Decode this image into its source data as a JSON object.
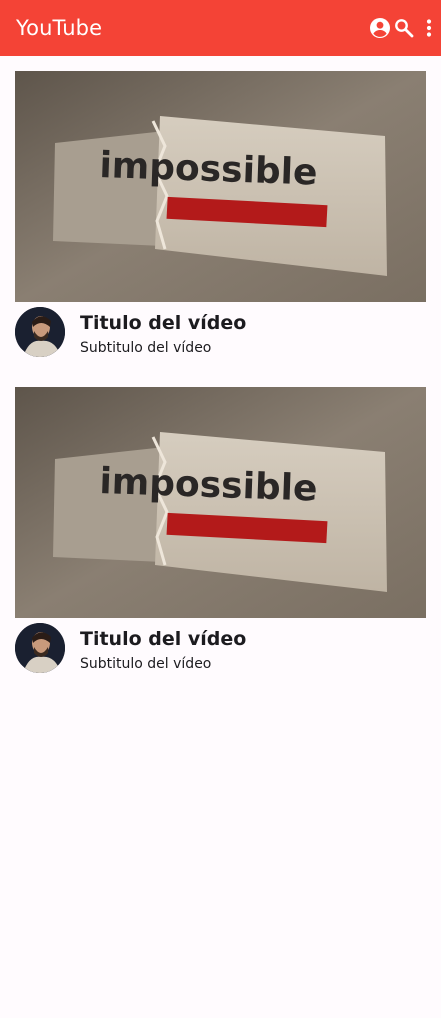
{
  "appbar": {
    "title": "YouTube",
    "background": "#f44336",
    "actions": [
      "account-circle-icon",
      "search-icon",
      "more-vert-icon"
    ]
  },
  "videos": [
    {
      "thumbnail_text": "impossible",
      "title": "Titulo del vídeo",
      "subtitle": "Subtitulo del vídeo"
    },
    {
      "thumbnail_text": "impossible",
      "title": "Titulo del vídeo",
      "subtitle": "Subtitulo del vídeo"
    }
  ]
}
